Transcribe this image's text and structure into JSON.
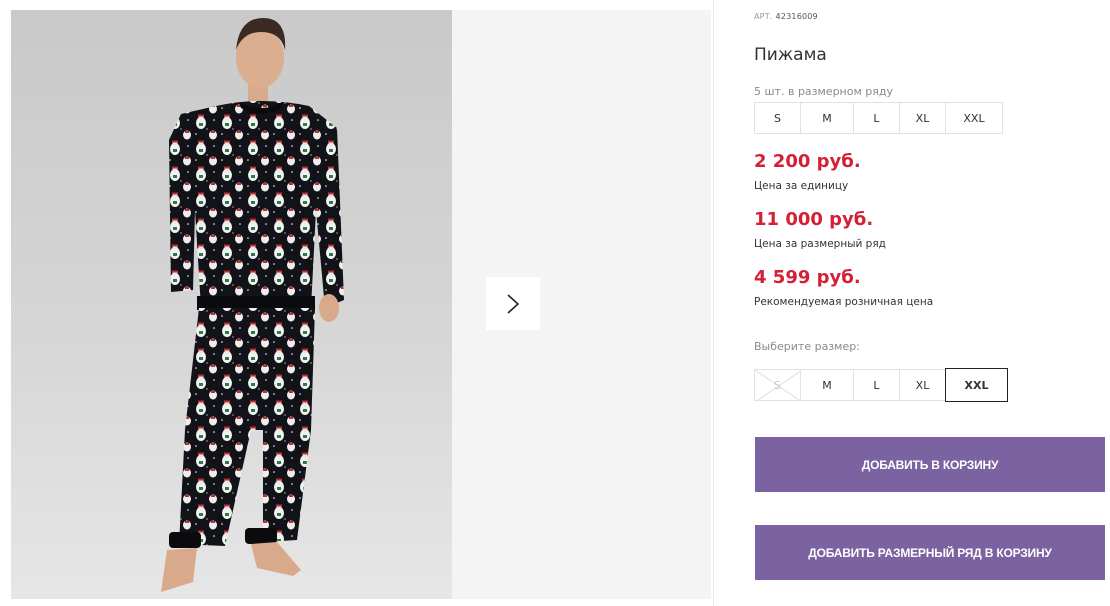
{
  "product": {
    "article_label": "АРТ.",
    "article": "42316009",
    "title": "Пижама",
    "range_note": "5 шт. в размерном ряду"
  },
  "size_range": [
    "S",
    "M",
    "L",
    "XL",
    "XXL"
  ],
  "prices": [
    {
      "value": "2 200 руб.",
      "label": "Цена за единицу"
    },
    {
      "value": "11 000 руб.",
      "label": "Цена за размерный ряд"
    },
    {
      "value": "4 599 руб.",
      "label": "Рекомендуемая розничная цена"
    }
  ],
  "size_select": {
    "label": "Выберите размер:",
    "options": [
      {
        "label": "S",
        "state": "unavailable"
      },
      {
        "label": "M",
        "state": "available"
      },
      {
        "label": "L",
        "state": "available"
      },
      {
        "label": "XL",
        "state": "available"
      },
      {
        "label": "XXL",
        "state": "selected"
      }
    ]
  },
  "actions": {
    "add_to_cart": "ДОБАВИТЬ В КОРЗИНУ",
    "add_range_to_cart": "ДОБАВИТЬ РАЗМЕРНЫЙ РЯД В КОРЗИНУ"
  },
  "gallery": {
    "next_icon": "chevron-right-icon",
    "photo": "man-in-black-polar-bear-pajamas"
  },
  "colors": {
    "price": "#d41f35",
    "button": "#7b63a1",
    "selected_border": "#222222"
  }
}
